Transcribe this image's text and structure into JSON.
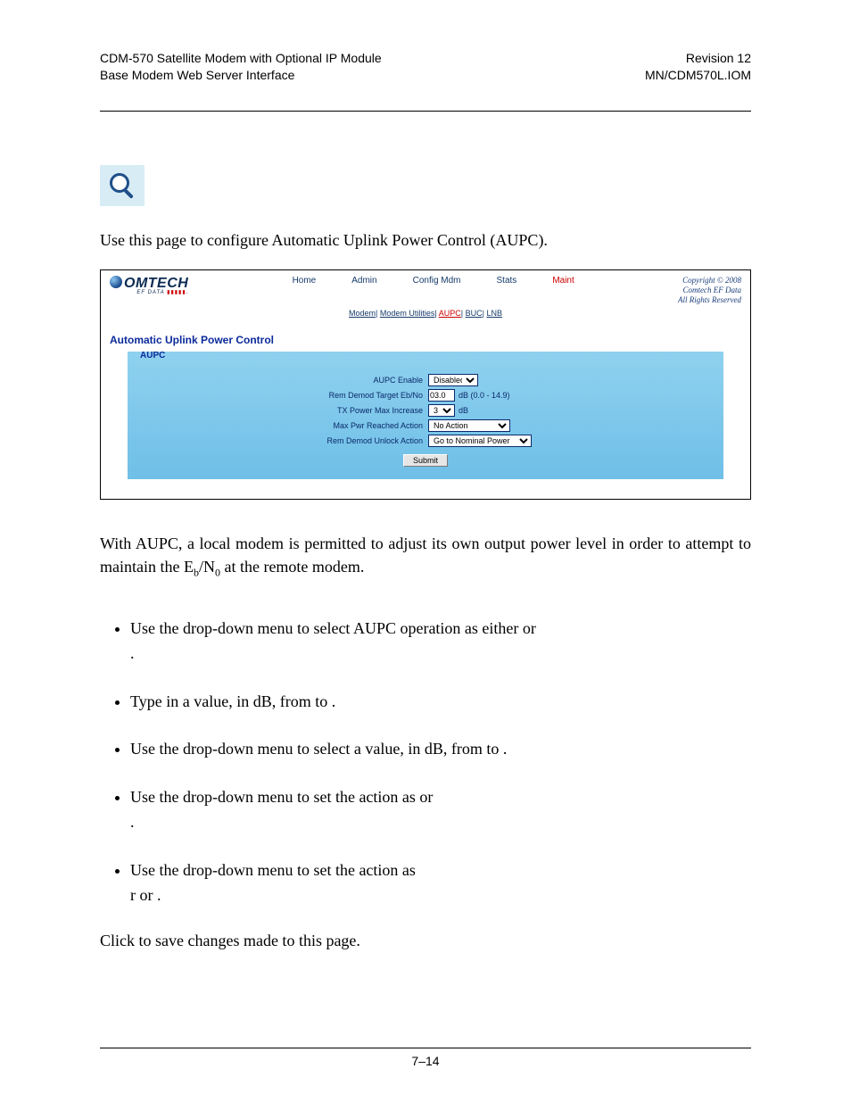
{
  "header": {
    "left1": "CDM-570 Satellite Modem with Optional IP Module",
    "left2": "Base Modem Web Server Interface",
    "right1": "Revision 12",
    "right2": "MN/CDM570L.IOM"
  },
  "intro": "Use this page to configure Automatic Uplink Power Control (AUPC).",
  "screenshot": {
    "brand": "OMTECH",
    "brand_sub": "EF DATA ",
    "brand_sub_red": "▮▮▮▮▮.",
    "nav": [
      "Home",
      "Admin",
      "Config Mdm",
      "Stats",
      "Maint"
    ],
    "subnav": [
      "Modem",
      "Modem Utilities",
      "AUPC",
      "BUC",
      "LNB"
    ],
    "subnav_active_index": 2,
    "copyright_l1": "Copyright © 2008",
    "copyright_l2": "Comtech EF Data",
    "copyright_l3": "All Rights Reserved",
    "title": "Automatic Uplink Power Control",
    "group_title": "AUPC",
    "rows": {
      "enable_label": "AUPC Enable",
      "enable_value": "Disabled",
      "target_label": "Rem Demod Target Eb/No",
      "target_value": "03.0",
      "target_hint": "dB (0.0 - 14.9)",
      "txmax_label": "TX Power Max Increase",
      "txmax_value": "3",
      "txmax_unit": "dB",
      "maxpwr_label": "Max Pwr Reached Action",
      "maxpwr_value": "No Action",
      "unlock_label": "Rem Demod Unlock Action",
      "unlock_value": "Go to Nominal Power"
    },
    "submit_label": "Submit"
  },
  "body1_a": "With AUPC, a local modem is permitted to adjust its own output power level in order to attempt to maintain the E",
  "body1_sub1": "b",
  "body1_mid": "/N",
  "body1_sub2": "0",
  "body1_b": " at the remote modem.",
  "bullets": [
    {
      "lead": "",
      "text_a": "Use the drop-down menu to select AUPC operation as either ",
      "text_b": " or ",
      "tail": "."
    },
    {
      "lead": "",
      "text_a": "Type in a value, in dB, from ",
      "text_b": " to ",
      "tail": "."
    },
    {
      "lead": "",
      "text_a": "Use the drop-down menu to select  a value, in dB, from ",
      "text_b": " to ",
      "tail": "."
    },
    {
      "lead": "",
      "text_a": "Use the drop-down menu to set the action as ",
      "text_b": " or ",
      "tail": "."
    },
    {
      "lead": "",
      "text_a": "Use the drop-down menu to set the action as ",
      "text_b": "r or ",
      "tail": "."
    }
  ],
  "afterlist_a": "Click ",
  "afterlist_b": " to save changes made to this page.",
  "footer_page": "7–14"
}
